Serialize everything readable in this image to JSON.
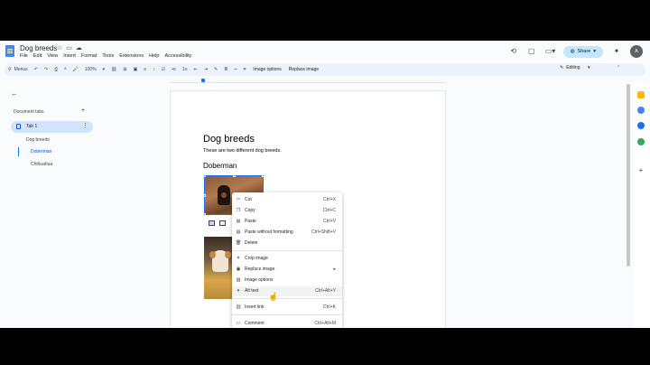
{
  "doc": {
    "title": "Dog breeds",
    "menus": [
      "File",
      "Edit",
      "View",
      "Insert",
      "Format",
      "Tools",
      "Extensions",
      "Help",
      "Accessibility"
    ]
  },
  "header": {
    "share_label": "Share",
    "avatar_initial": "A"
  },
  "toolbar": {
    "search_label": "Menus",
    "zoom": "100%",
    "image_options": "Image options",
    "replace_image": "Replace image",
    "mode": "Editing"
  },
  "sidebar": {
    "section_label": "Document tabs",
    "tab_label": "Tab 1",
    "outline": [
      "Dog breeds",
      "Doberman",
      "Chihuahua"
    ]
  },
  "page": {
    "heading": "Dog breeds",
    "paragraph": "These are two different dog breeds.",
    "subheading": "Doberman"
  },
  "context_menu": {
    "items": [
      {
        "label": "Cut",
        "shortcut": "Ctrl+X",
        "icon": "scissors-icon"
      },
      {
        "label": "Copy",
        "shortcut": "Ctrl+C",
        "icon": "copy-icon"
      },
      {
        "label": "Paste",
        "shortcut": "Ctrl+V",
        "icon": "paste-icon"
      },
      {
        "label": "Paste without formatting",
        "shortcut": "Ctrl+Shift+V",
        "icon": "paste-plain-icon"
      },
      {
        "label": "Delete",
        "shortcut": "",
        "icon": "trash-icon"
      },
      {
        "label": "Crop image",
        "shortcut": "",
        "icon": "crop-icon"
      },
      {
        "label": "Replace image",
        "shortcut": "▸",
        "icon": "image-icon"
      },
      {
        "label": "Image options",
        "shortcut": "",
        "icon": "image-options-icon"
      },
      {
        "label": "Alt text",
        "shortcut": "Ctrl+Alt+Y",
        "icon": "alt-text-icon"
      },
      {
        "label": "Insert link",
        "shortcut": "Ctrl+K",
        "icon": "link-icon"
      },
      {
        "label": "Comment",
        "shortcut": "Ctrl+Alt+M",
        "icon": "comment-icon"
      }
    ]
  },
  "colors": {
    "accent": "#1a73e8",
    "share_bg": "#c2e7ff",
    "tab_selected_bg": "#d3e3fd"
  }
}
